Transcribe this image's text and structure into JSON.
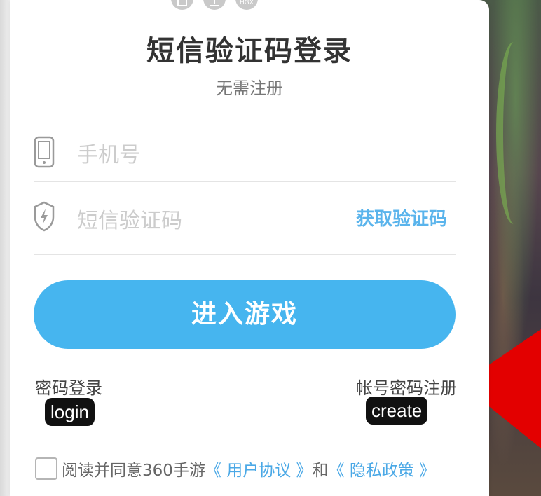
{
  "top_icons": [
    "share-icon",
    "export-icon",
    "HGX"
  ],
  "dialog": {
    "title": "短信验证码登录",
    "subtitle": "无需注册",
    "phone_placeholder": "手机号",
    "code_placeholder": "短信验证码",
    "get_code_label": "获取验证码",
    "enter_label": "进入游戏",
    "password_login_label": "密码登录",
    "register_label": "帐号密码注册",
    "agreement": {
      "prefix": "阅读并同意360手游",
      "user_agreement": "《 用户协议 》",
      "and": "和",
      "privacy_policy": "《 隐私政策 》"
    }
  },
  "overlay_tags": {
    "login": "login",
    "create": "create"
  },
  "colors": {
    "accent": "#46b5ef",
    "link": "#4aa8e6",
    "arrow": "#e30000"
  }
}
